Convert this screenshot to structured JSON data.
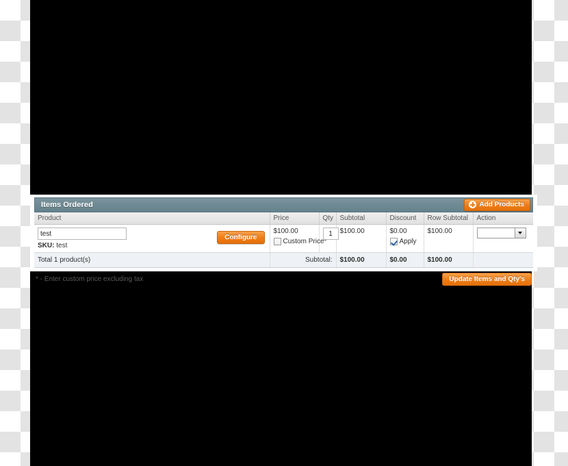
{
  "panel": {
    "title": "Items Ordered",
    "add_products_label": "Add Products",
    "add_products_icon": "plus-circle-icon"
  },
  "table": {
    "columns": [
      "Product",
      "Price",
      "Qty",
      "Subtotal",
      "Discount",
      "Row Subtotal",
      "Action"
    ],
    "rows": [
      {
        "product_name": "test",
        "product_name_placeholder": "",
        "sku_label": "SKU:",
        "sku_value": "test",
        "configure_label": "Configure",
        "price": "$100.00",
        "custom_price_label": "Custom Price*",
        "custom_price_checked": false,
        "qty": "1",
        "subtotal": "$100.00",
        "discount": "$0.00",
        "apply_label": "Apply",
        "apply_checked": true,
        "row_subtotal": "$100.00",
        "action_value": ""
      }
    ],
    "totals": {
      "product_count_label": "Total 1 product(s)",
      "subtotal_label": "Subtotal:",
      "subtotal_value": "$100.00",
      "discount_value": "$0.00",
      "row_subtotal_value": "$100.00"
    }
  },
  "footer": {
    "note": "* - Enter custom price excluding tax",
    "update_label": "Update Items and Qty's"
  },
  "colors": {
    "panel_header": "#6f8a94",
    "accent_orange": "#ef7e18",
    "totals_row": "#eef1f5",
    "column_header": "#e7e7e7",
    "mask": "#000000"
  }
}
